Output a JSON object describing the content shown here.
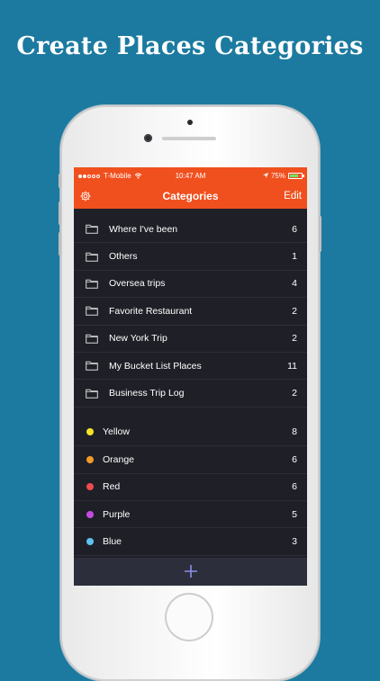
{
  "headline": "Create Places Categories",
  "status_bar": {
    "carrier": "T-Mobile",
    "time": "10:47 AM",
    "battery": "75%",
    "battery_level": 0.75
  },
  "nav": {
    "title": "Categories",
    "edit_label": "Edit"
  },
  "folders": [
    {
      "label": "Where I've been",
      "count": "6"
    },
    {
      "label": "Others",
      "count": "1"
    },
    {
      "label": "Oversea trips",
      "count": "4"
    },
    {
      "label": "Favorite Restaurant",
      "count": "2"
    },
    {
      "label": "New York Trip",
      "count": "2"
    },
    {
      "label": "My Bucket List Places",
      "count": "11"
    },
    {
      "label": "Business Trip Log",
      "count": "2"
    }
  ],
  "colors": [
    {
      "label": "Yellow",
      "count": "8",
      "color": "#f2e42a"
    },
    {
      "label": "Orange",
      "count": "6",
      "color": "#f39a2b"
    },
    {
      "label": "Red",
      "count": "6",
      "color": "#ef4a4f"
    },
    {
      "label": "Purple",
      "count": "5",
      "color": "#c64be0"
    },
    {
      "label": "Blue",
      "count": "3",
      "color": "#5cc3ee"
    }
  ],
  "theme": {
    "background": "#1c7aa0",
    "accent": "#f0501e",
    "list_bg": "#1f2027"
  },
  "icons": {
    "settings": "gear-icon",
    "folder": "folder-icon",
    "add": "plus-icon"
  }
}
